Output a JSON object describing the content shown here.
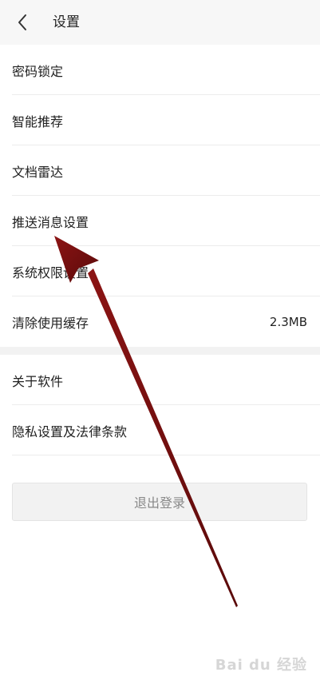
{
  "header": {
    "title": "设置",
    "back_icon": "chevron-left-icon"
  },
  "group1": {
    "items": [
      {
        "label": "密码锁定"
      },
      {
        "label": "智能推荐"
      },
      {
        "label": "文档雷达"
      },
      {
        "label": "推送消息设置"
      },
      {
        "label": "系统权限设置"
      },
      {
        "label": "清除使用缓存",
        "value": "2.3MB"
      }
    ]
  },
  "group2": {
    "items": [
      {
        "label": "关于软件"
      },
      {
        "label": "隐私设置及法律条款"
      }
    ]
  },
  "logout": {
    "label": "退出登录"
  },
  "annotation": {
    "arrow_color": "#7a1010"
  },
  "watermark": {
    "text": "Bai du 经验"
  }
}
